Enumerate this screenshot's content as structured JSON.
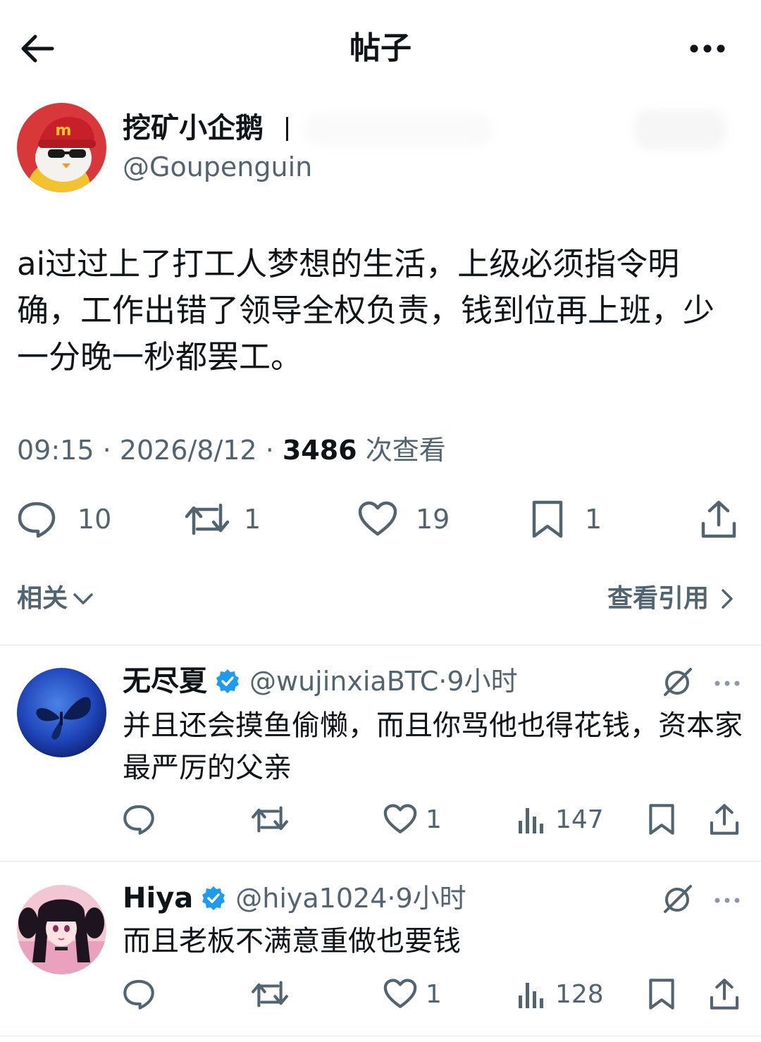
{
  "header": {
    "title": "帖子",
    "back_icon": "arrow-left-icon",
    "more_icon": "more-horizontal-icon"
  },
  "post": {
    "author_name": "挖矿小企鹅",
    "author_handle": "@Goupenguin",
    "text": "ai过过上了打工人梦想的生活，上级必须指令明确，工作出错了领导全权负责，钱到位再上班，少一分晚一秒都罢工。",
    "time": "09:15",
    "sep1": " · ",
    "date": "2026/8/12",
    "sep2": " · ",
    "views_count": "3486",
    "views_label": " 次查看",
    "actions": {
      "replies": "10",
      "reposts": "1",
      "likes": "19",
      "bookmarks": "1"
    }
  },
  "related_row": {
    "related_label": "相关",
    "quotes_label": "查看引用"
  },
  "replies": [
    {
      "name": "无尽夏",
      "handle": "@wujinxiaBTC",
      "sep": " · ",
      "time": "9小时",
      "text": "并且还会摸鱼偷懒，而且你骂他也得花钱，资本家最严厉的父亲",
      "likes": "1",
      "views": "147"
    },
    {
      "name": "Hiya",
      "handle": "@hiya1024",
      "sep": " · ",
      "time": "9小时",
      "text": "而且老板不满意重做也要钱",
      "likes": "1",
      "views": "128"
    }
  ],
  "colors": {
    "text_primary": "#0f1419",
    "text_secondary": "#536471",
    "verified_blue": "#1d9bf0",
    "divider": "#e1e8ed"
  }
}
